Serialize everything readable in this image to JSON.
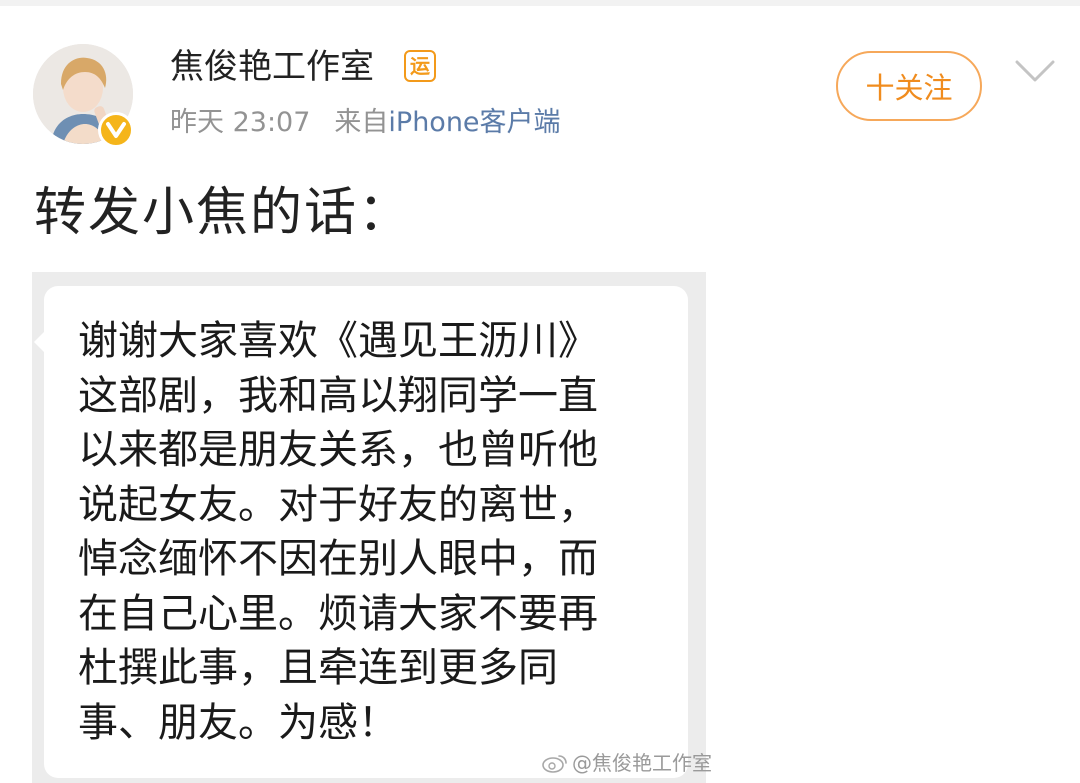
{
  "post": {
    "author": {
      "name": "焦俊艳工作室",
      "level_badge": "运",
      "verified": true
    },
    "time": "昨天 23:07",
    "source_prefix": "来自",
    "source_client": "iPhone客户端",
    "follow_label": "十关注",
    "text": "转发小焦的话："
  },
  "image": {
    "lines": [
      "谢谢大家喜欢《遇见王沥川》",
      "这部剧，我和高以翔同学一直",
      "以来都是朋友关系，也曾听他",
      "说起女友。对于好友的离世，",
      "悼念缅怀不因在别人眼中，而",
      "在自己心里。烦请大家不要再",
      "杜撰此事，且牵连到更多同",
      "事、朋友。为感！"
    ],
    "watermark": "@焦俊艳工作室"
  },
  "colors": {
    "follow_accent": "#f08c1e",
    "client_link": "#5b7ba8",
    "verified_badge": "#f5b51a",
    "meta_gray": "#939393"
  },
  "icons": {
    "avatar": "avatar-image",
    "verified": "verified-v-icon",
    "menu": "chevron-down-icon",
    "watermark_logo": "weibo-logo-icon"
  }
}
